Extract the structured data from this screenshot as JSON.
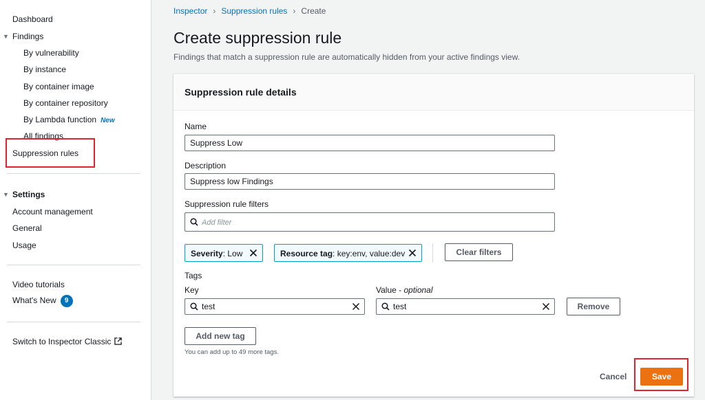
{
  "sidebar": {
    "dashboard": "Dashboard",
    "findings": {
      "label": "Findings",
      "items": [
        "By vulnerability",
        "By instance",
        "By container image",
        "By container repository",
        "By Lambda function",
        "All findings"
      ],
      "new_badge": "New"
    },
    "suppression_rules": "Suppression rules",
    "settings": {
      "label": "Settings",
      "items": [
        "Account management",
        "General",
        "Usage"
      ]
    },
    "video_tutorials": "Video tutorials",
    "whats_new": "What's New",
    "whats_new_count": "9",
    "switch_classic": "Switch to Inspector Classic"
  },
  "breadcrumb": {
    "items": [
      "Inspector",
      "Suppression rules"
    ],
    "current": "Create"
  },
  "page": {
    "title": "Create suppression rule",
    "description": "Findings that match a suppression rule are automatically hidden from your active findings view."
  },
  "card": {
    "title": "Suppression rule details",
    "name_label": "Name",
    "name_value": "Suppress Low",
    "description_label": "Description",
    "description_value": "Suppress low Findings",
    "filters_label": "Suppression rule filters",
    "filter_placeholder": "Add filter",
    "tokens": [
      {
        "key": "Severity",
        "value": ": Low"
      },
      {
        "key": "Resource tag",
        "value": ": key:env, value:dev"
      }
    ],
    "clear_filters": "Clear filters",
    "tags_label": "Tags",
    "key_label": "Key",
    "value_label": "Value - ",
    "value_optional": "optional",
    "key_value": "test",
    "value_value": "test",
    "remove": "Remove",
    "add_tag": "Add new tag",
    "hint": "You can add up to 49 more tags."
  },
  "footer": {
    "cancel": "Cancel",
    "save": "Save"
  },
  "colors": {
    "accent": "#0073bb",
    "primary_button": "#ec7211",
    "highlight": "#e0232e",
    "token_border": "#00a1c9"
  }
}
